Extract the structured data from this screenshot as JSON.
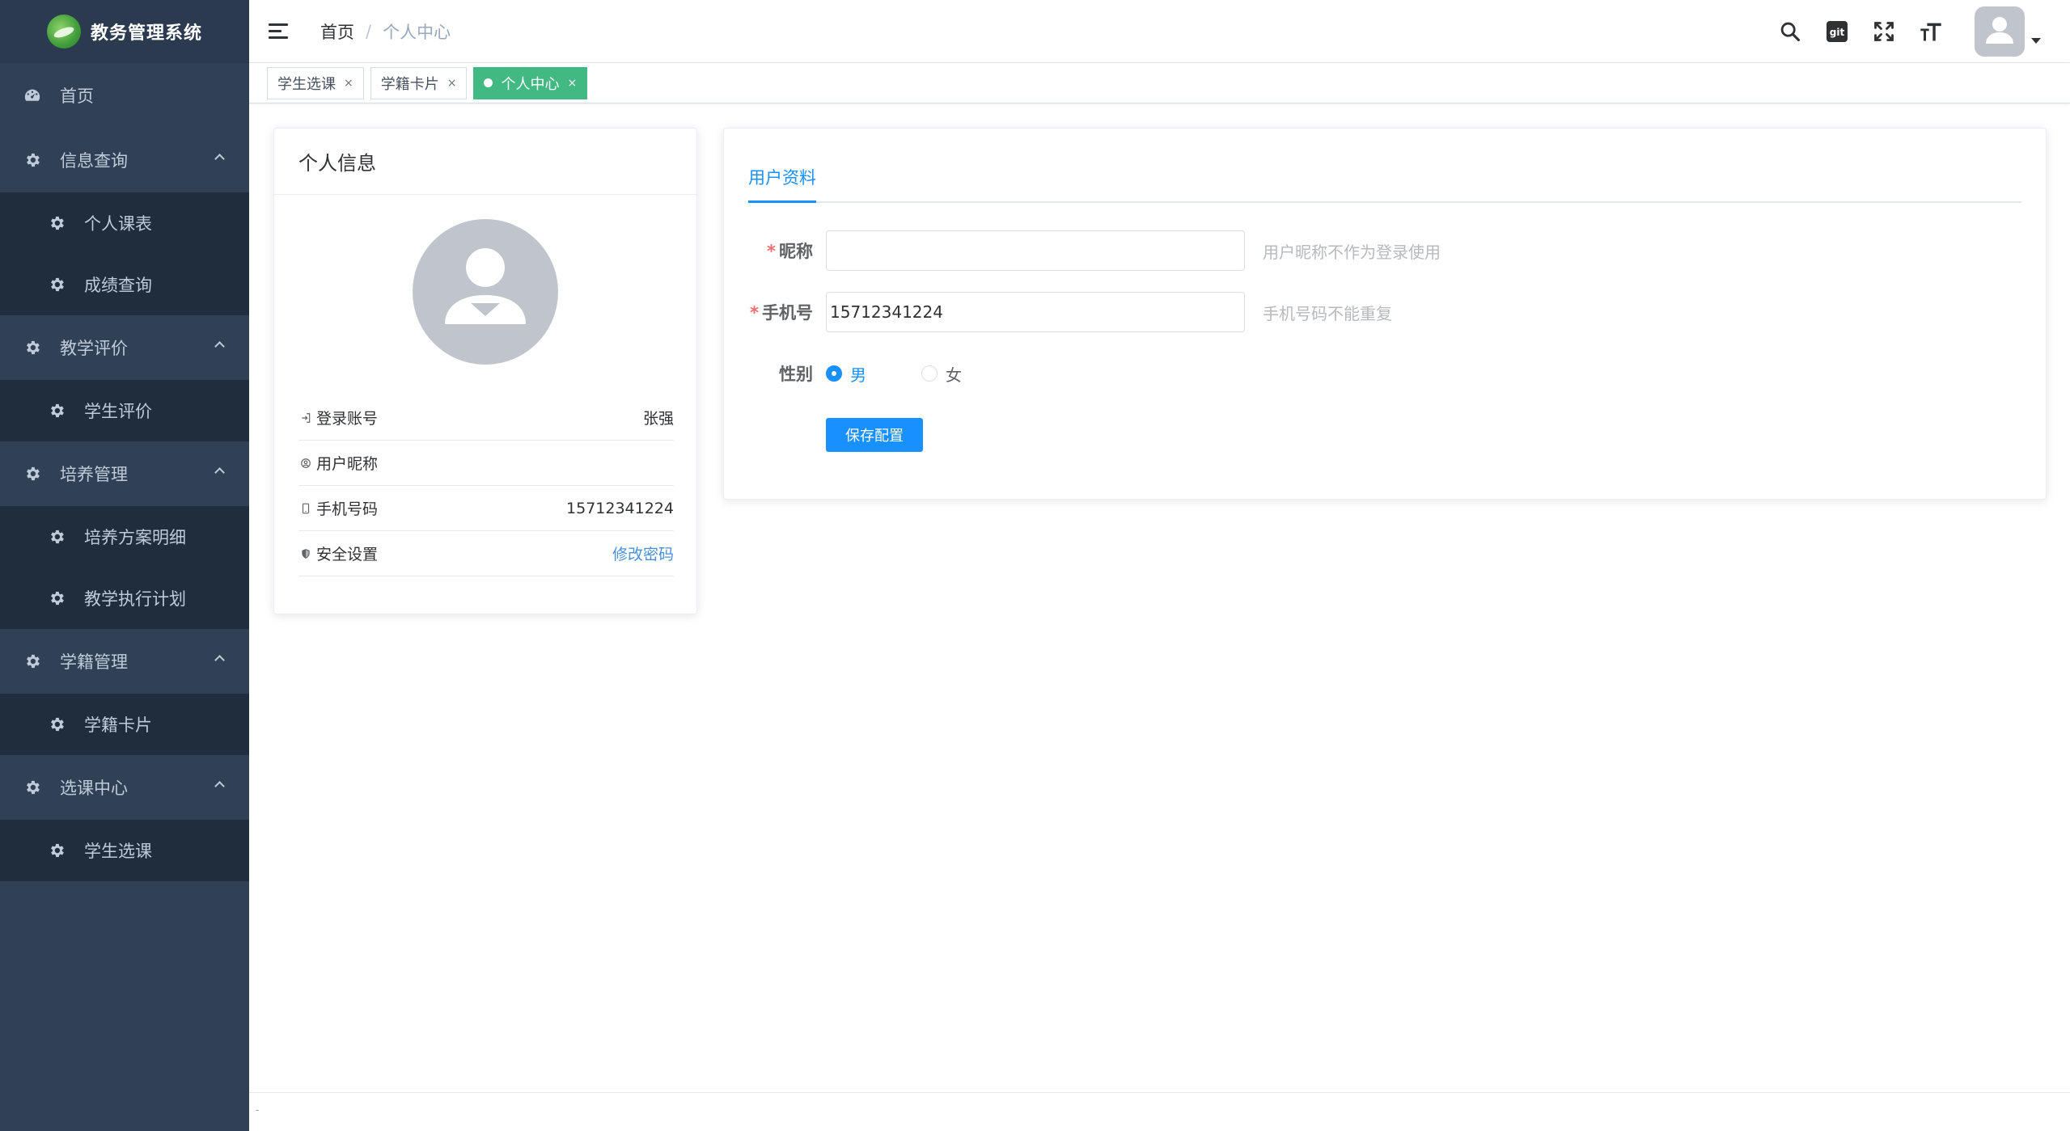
{
  "app": {
    "title": "教务管理系统"
  },
  "sidebar": {
    "items": [
      {
        "label": "首页",
        "icon": "dashboard-icon"
      },
      {
        "label": "信息查询",
        "icon": "gear-icon",
        "children": [
          {
            "label": "个人课表"
          },
          {
            "label": "成绩查询"
          }
        ]
      },
      {
        "label": "教学评价",
        "icon": "gear-icon",
        "children": [
          {
            "label": "学生评价"
          }
        ]
      },
      {
        "label": "培养管理",
        "icon": "gear-icon",
        "children": [
          {
            "label": "培养方案明细"
          },
          {
            "label": "教学执行计划"
          }
        ]
      },
      {
        "label": "学籍管理",
        "icon": "gear-icon",
        "children": [
          {
            "label": "学籍卡片"
          }
        ]
      },
      {
        "label": "选课中心",
        "icon": "gear-icon",
        "children": [
          {
            "label": "学生选课"
          }
        ]
      }
    ]
  },
  "breadcrumb": {
    "home": "首页",
    "separator": "/",
    "current": "个人中心"
  },
  "header": {
    "git_label": "git"
  },
  "tags": [
    {
      "label": "学生选课",
      "close": "×",
      "active": false
    },
    {
      "label": "学籍卡片",
      "close": "×",
      "active": false
    },
    {
      "label": "个人中心",
      "close": "×",
      "active": true
    }
  ],
  "profile": {
    "title": "个人信息",
    "rows": [
      {
        "label": "登录账号",
        "value": "张强"
      },
      {
        "label": "用户昵称",
        "value": ""
      },
      {
        "label": "手机号码",
        "value": "15712341224"
      },
      {
        "label": "安全设置",
        "value": "修改密码"
      }
    ]
  },
  "user_form": {
    "tab": "用户资料",
    "required_mark": "*",
    "nickname": {
      "label": "昵称",
      "value": "",
      "hint": "用户昵称不作为登录使用"
    },
    "phone": {
      "label": "手机号",
      "value": "15712341224",
      "hint": "手机号码不能重复"
    },
    "gender": {
      "label": "性别",
      "options": [
        "男",
        "女"
      ],
      "selected": "男"
    },
    "save_label": "保存配置"
  },
  "footer": {
    "text": "-"
  },
  "colors": {
    "sidebar_bg": "#304156",
    "submenu_bg": "#1f2d3d",
    "accent": "#1890ff",
    "active_tag": "#42b983"
  }
}
